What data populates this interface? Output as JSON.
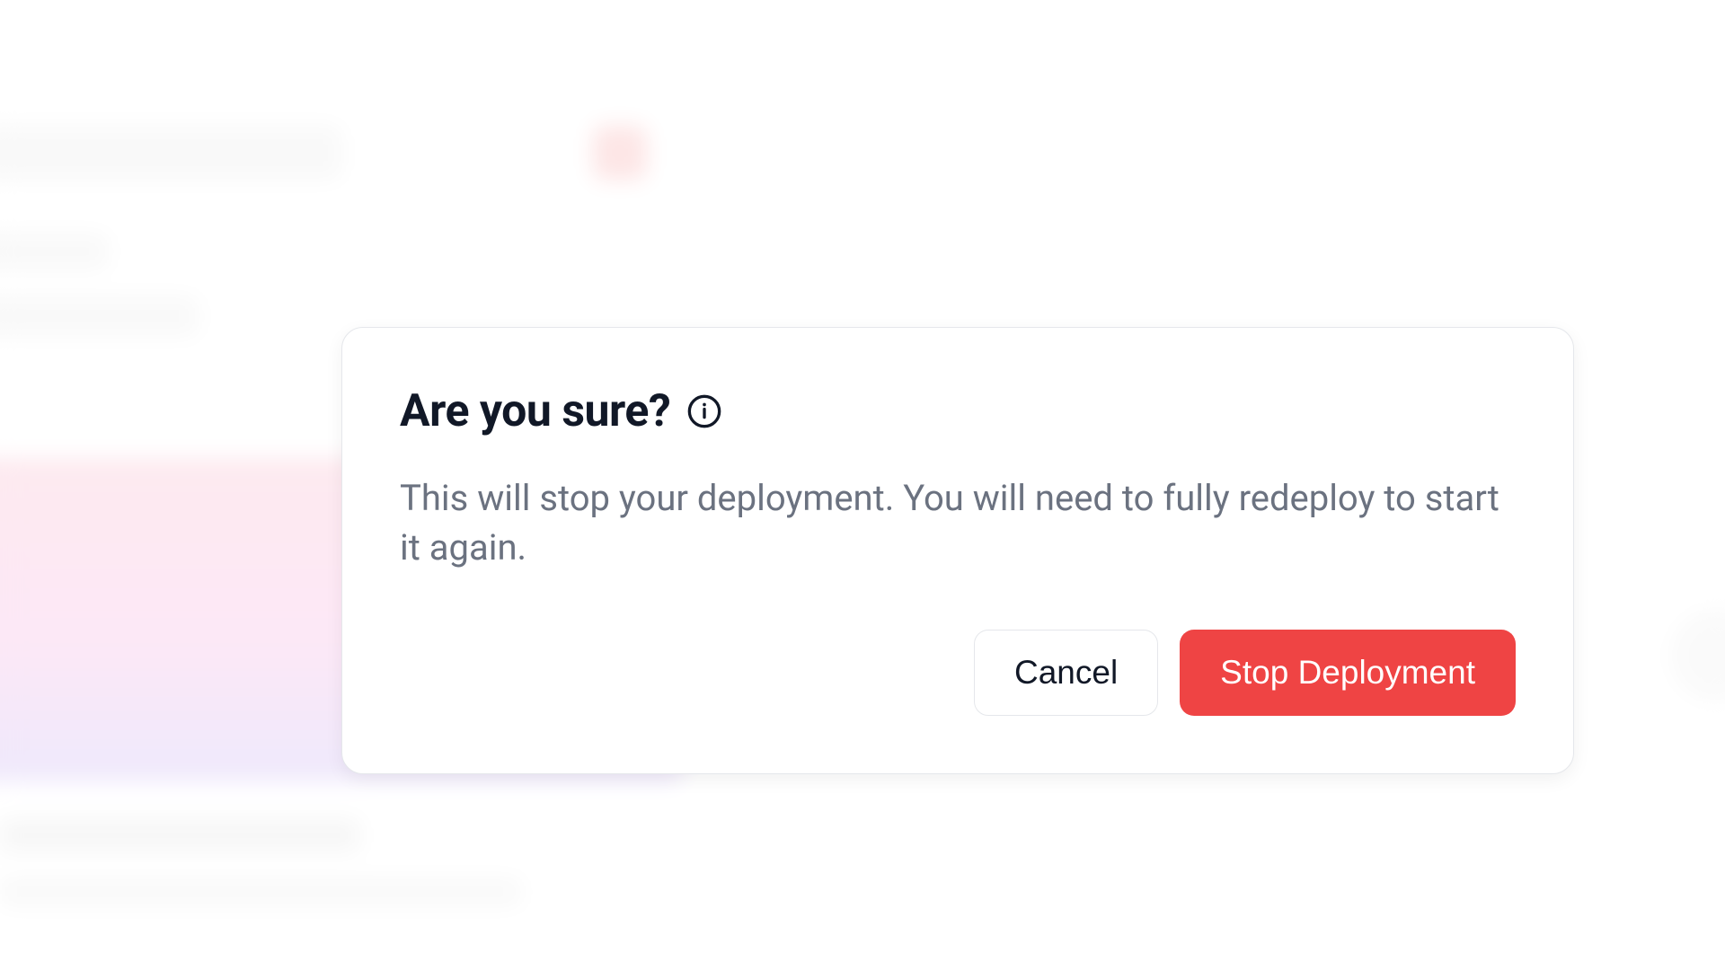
{
  "modal": {
    "title": "Are you sure?",
    "icon_name": "info-icon",
    "message": "This will stop your deployment. You will need to fully redeploy to start it again.",
    "cancel_label": "Cancel",
    "confirm_label": "Stop Deployment"
  },
  "colors": {
    "danger": "#ef4444",
    "text_primary": "#111827",
    "text_secondary": "#6b7280",
    "border": "#e5e7eb"
  }
}
